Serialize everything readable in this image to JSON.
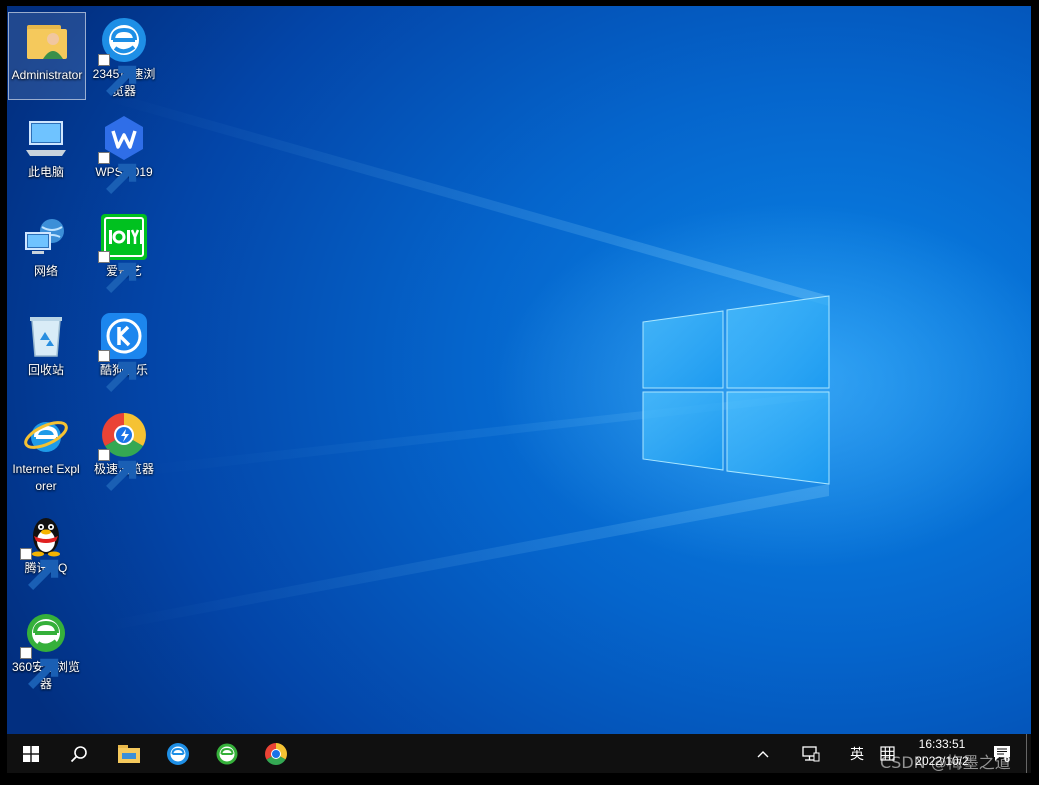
{
  "desktop": {
    "icons": [
      {
        "label": "Administrator",
        "icon": "user-folder-icon"
      },
      {
        "label": "2345加速浏览器",
        "icon": "browser-2345-icon"
      },
      {
        "label": "此电脑",
        "icon": "this-pc-icon"
      },
      {
        "label": "WPS 2019",
        "icon": "wps-icon"
      },
      {
        "label": "网络",
        "icon": "network-icon"
      },
      {
        "label": "爱奇艺",
        "icon": "iqiyi-icon"
      },
      {
        "label": "回收站",
        "icon": "recycle-bin-icon"
      },
      {
        "label": "酷狗音乐",
        "icon": "kugou-icon"
      },
      {
        "label": "Internet Explorer",
        "icon": "internet-explorer-icon"
      },
      {
        "label": "极速浏览器",
        "icon": "chrome-like-browser-icon"
      },
      {
        "label": "腾讯QQ",
        "icon": "qq-penguin-icon"
      },
      {
        "label": "360安全浏览器",
        "icon": "browser-360-icon"
      }
    ]
  },
  "taskbar": {
    "language": "英",
    "time": "16:33:51",
    "date": "2022/10/2",
    "notification_count": "6"
  },
  "watermark": "CSDN @梅墨之道",
  "colors": {
    "accent": "#0078d7",
    "taskbar": "#101010"
  }
}
